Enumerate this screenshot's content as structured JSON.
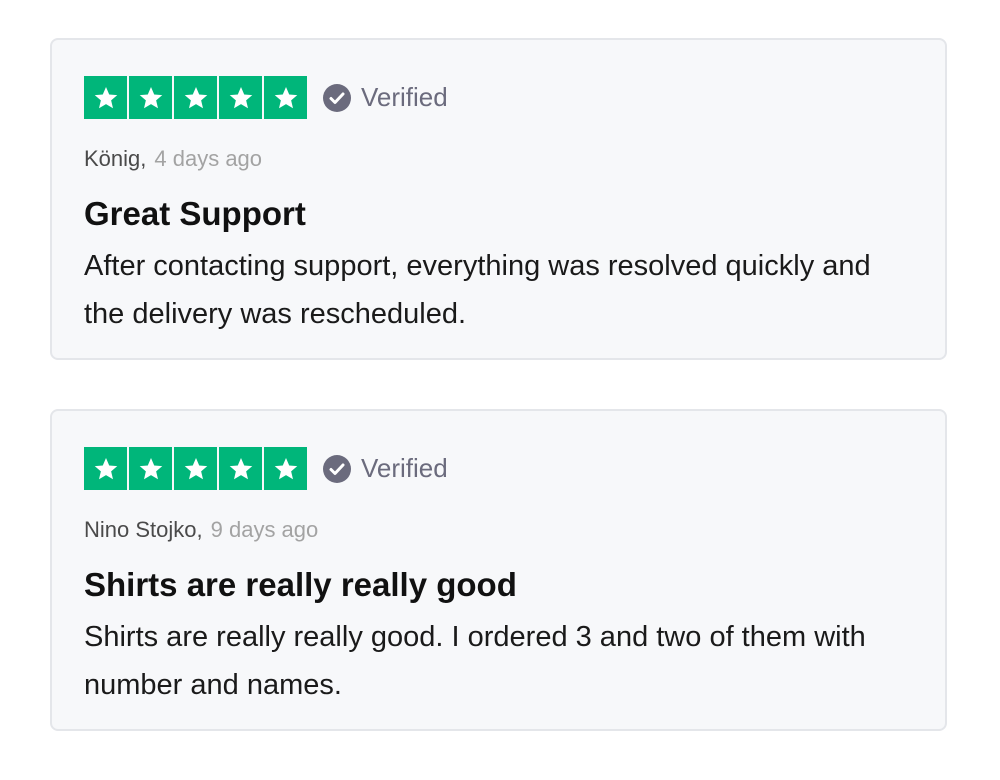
{
  "colors": {
    "star_green": "#00b67a",
    "verified_gray": "#6b6b7d",
    "card_background": "#f7f8fa"
  },
  "reviews": [
    {
      "rating": 5,
      "max_rating": 5,
      "verified_label": "Verified",
      "verified_icon": "check-circle-icon",
      "author": "König,",
      "date": "4 days ago",
      "title": "Great Support",
      "body": "After contacting support, everything was resolved quickly and the delivery was rescheduled."
    },
    {
      "rating": 5,
      "max_rating": 5,
      "verified_label": "Verified",
      "verified_icon": "check-circle-icon",
      "author": "Nino Stojko,",
      "date": "9 days ago",
      "title": "Shirts are really really good",
      "body": "Shirts are really really good. I ordered 3 and two of them with number and names."
    }
  ]
}
